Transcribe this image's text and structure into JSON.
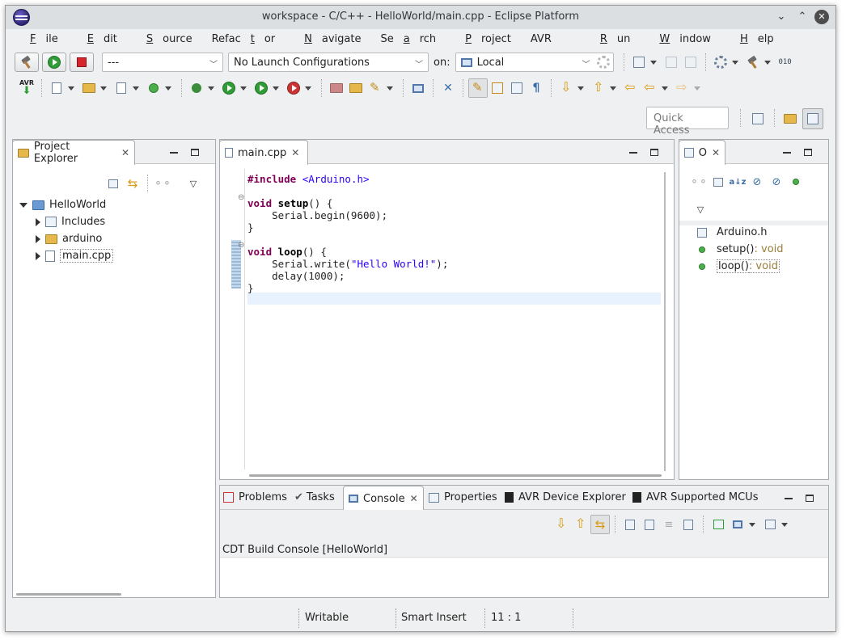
{
  "window": {
    "title": "workspace - C/C++ - HelloWorld/main.cpp - Eclipse Platform"
  },
  "menu": [
    {
      "pre": "",
      "u": "F",
      "post": "ile"
    },
    {
      "pre": "",
      "u": "E",
      "post": "dit"
    },
    {
      "pre": "",
      "u": "S",
      "post": "ource"
    },
    {
      "pre": "Refac",
      "u": "t",
      "post": "or"
    },
    {
      "pre": "",
      "u": "N",
      "post": "avigate"
    },
    {
      "pre": "Se",
      "u": "a",
      "post": "rch"
    },
    {
      "pre": "",
      "u": "P",
      "post": "roject"
    },
    {
      "pre": "AVR",
      "u": "",
      "post": ""
    },
    {
      "pre": "",
      "u": "R",
      "post": "un"
    },
    {
      "pre": "",
      "u": "W",
      "post": "indow"
    },
    {
      "pre": "",
      "u": "H",
      "post": "elp"
    }
  ],
  "toolbar": {
    "launch_mode": "---",
    "launch_config": "No Launch Configurations",
    "on_label": "on:",
    "target": "Local",
    "avr_label": "AVR",
    "quick_access_placeholder": "Quick Access"
  },
  "project_explorer": {
    "title": "Project Explorer",
    "tree": {
      "root": "HelloWorld",
      "children": [
        "Includes",
        "arduino",
        "main.cpp"
      ]
    }
  },
  "editor": {
    "tab": "main.cpp",
    "lines": {
      "l1_kw": "#include",
      "l1_inc": " <Arduino.h>",
      "l3_kw": "void",
      "l3_fn": "setup",
      "l3_rest": "() {",
      "l4": "    Serial.begin(9600);",
      "l5": "}",
      "l7_kw": "void",
      "l7_fn": "loop",
      "l7_rest": "() {",
      "l8_a": "    Serial.write(",
      "l8_str": "\"Hello World!\"",
      "l8_b": ");",
      "l9": "    delay(1000);",
      "l10": "}"
    }
  },
  "outline": {
    "title": "O",
    "items": [
      {
        "name": "Arduino.h",
        "type": ""
      },
      {
        "name": "setup()",
        "type": " : void"
      },
      {
        "name": "loop()",
        "type": " : void"
      }
    ]
  },
  "bottom_tabs": [
    "Problems",
    "Tasks",
    "Console",
    "Properties",
    "AVR Device Explorer",
    "AVR Supported MCUs"
  ],
  "console": {
    "title": "CDT Build Console [HelloWorld]"
  },
  "status": {
    "writable": "Writable",
    "insert_mode": "Smart Insert",
    "position": "11 : 1"
  }
}
